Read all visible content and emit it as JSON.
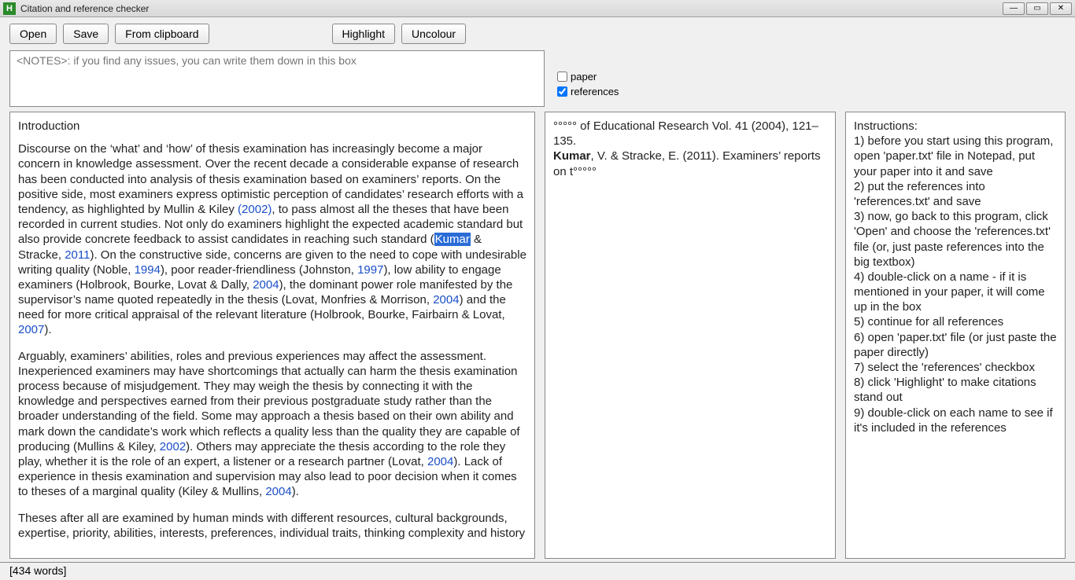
{
  "window": {
    "title": "Citation and reference checker",
    "icon_letter": "H"
  },
  "toolbar": {
    "open": "Open",
    "save": "Save",
    "from_clipboard": "From clipboard",
    "highlight": "Highlight",
    "uncolour": "Uncolour"
  },
  "notes_placeholder": "<NOTES>: if you find any issues, you can write them down in this box",
  "checkboxes": {
    "paper_label": "paper",
    "paper_checked": false,
    "references_label": "references",
    "references_checked": true
  },
  "paper": {
    "heading": "Introduction",
    "p1a": "Discourse on the ‘what’ and ‘how’ of thesis examination has increasingly become a major concern in knowledge assessment. Over the recent decade a considerable expanse of research has been conducted into analysis of thesis examination based on examiners’ reports. On the positive side, most examiners express optimistic perception of candidates’ research efforts with a tendency, as highlighted by Mullin & Kiley ",
    "c2002": "(2002)",
    "p1b": ", to pass almost all the theses that have been recorded in current studies. Not only do examiners highlight the expected academic standard but also provide concrete feedback to assist candidates in reaching such standard (",
    "kumar_hl": "Kumar",
    "p1c": " & Stracke, ",
    "c2011": "2011",
    "p1d": "). On the constructive side, concerns are given to the need to cope with undesirable writing quality (Noble, ",
    "c1994": "1994",
    "p1e": "), poor reader-friendliness (Johnston, ",
    "c1997": "1997",
    "p1f": "), low ability to engage examiners (Holbrook, Bourke, Lovat & Dally, ",
    "c2004a": "2004",
    "p1g": "), the dominant power role manifested by the supervisor’s name quoted repeatedly in the thesis (Lovat, Monfries & Morrison, ",
    "c2004b": "2004",
    "p1h": ") and the need for more critical appraisal of the relevant literature (Holbrook, Bourke, Fairbairn & Lovat, ",
    "c2007": "2007",
    "p1i": ").",
    "p2a": "Arguably, examiners’ abilities, roles and previous experiences may affect the assessment. Inexperienced examiners may have shortcomings that actually can harm the thesis examination process because of misjudgement. They may weigh the thesis by connecting it with the knowledge and perspectives earned from their previous postgraduate study rather than the broader understanding of the field. Some may approach a thesis based on their own ability and mark down the candidate’s work which reflects a quality less than the quality they are capable of producing (Mullins & Kiley, ",
    "c2002b": "2002",
    "p2b": "). Others may appreciate the thesis according to the role they play, whether it is the role of an expert, a listener or a research partner (Lovat, ",
    "c2004c": "2004",
    "p2c": "). Lack of experience in thesis examination and supervision may also lead to poor decision when it comes to theses of a marginal quality (Kiley & Mullins, ",
    "c2004d": "2004",
    "p2d": ").",
    "p3": "Theses after all are examined by human minds with different resources, cultural backgrounds, expertise, priority, abilities, interests, preferences, individual traits, thinking complexity and history"
  },
  "refs": {
    "line1a": "°°°°° of Educational Research Vol. 41 (2004), 121–135.",
    "line2_name": "Kumar",
    "line2_rest": ", V. & Stracke, E. (2011). Examiners’ reports on t°°°°°"
  },
  "instructions": {
    "title": "Instructions:",
    "i1": "1) before you start using this program, open 'paper.txt' file in Notepad, put your paper into it and save",
    "i2": "2) put the references into 'references.txt' and save",
    "i3": "3) now, go back to this program, click 'Open' and choose the 'references.txt' file (or, just paste references into the big textbox)",
    "i4": "4) double-click on a name - if it is mentioned in your paper, it will come up in the box",
    "i5": "5) continue for all references",
    "i6": "6) open 'paper.txt' file (or just paste the paper directly)",
    "i7": "7) select the 'references' checkbox",
    "i8": "8) click 'Highlight' to make citations stand out",
    "i9": "9) double-click on each name to see if it's included in the references"
  },
  "status": "[434 words]"
}
